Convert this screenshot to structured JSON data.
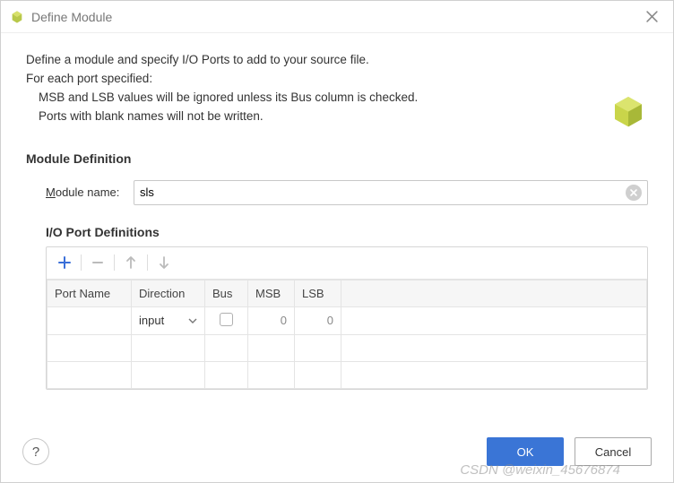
{
  "titlebar": {
    "title": "Define Module"
  },
  "description": {
    "line1": "Define a module and specify I/O Ports to add to your source file.",
    "line2": "For each port specified:",
    "line3": "MSB and LSB values will be ignored unless its Bus column is checked.",
    "line4": "Ports with blank names will not be written."
  },
  "module": {
    "section_title": "Module Definition",
    "name_label_pre": "M",
    "name_label_post": "odule name:",
    "name_value": "sls"
  },
  "io": {
    "title": "I/O Port Definitions",
    "headers": {
      "port_name": "Port Name",
      "direction": "Direction",
      "bus": "Bus",
      "msb": "MSB",
      "lsb": "LSB"
    },
    "rows": [
      {
        "port_name": "",
        "direction": "input",
        "bus": false,
        "msb": "0",
        "lsb": "0"
      },
      {
        "port_name": "",
        "direction": "",
        "bus": null,
        "msb": "",
        "lsb": ""
      },
      {
        "port_name": "",
        "direction": "",
        "bus": null,
        "msb": "",
        "lsb": ""
      }
    ]
  },
  "footer": {
    "help": "?",
    "ok": "OK",
    "cancel": "Cancel"
  },
  "watermark": "CSDN @weixin_45676874"
}
